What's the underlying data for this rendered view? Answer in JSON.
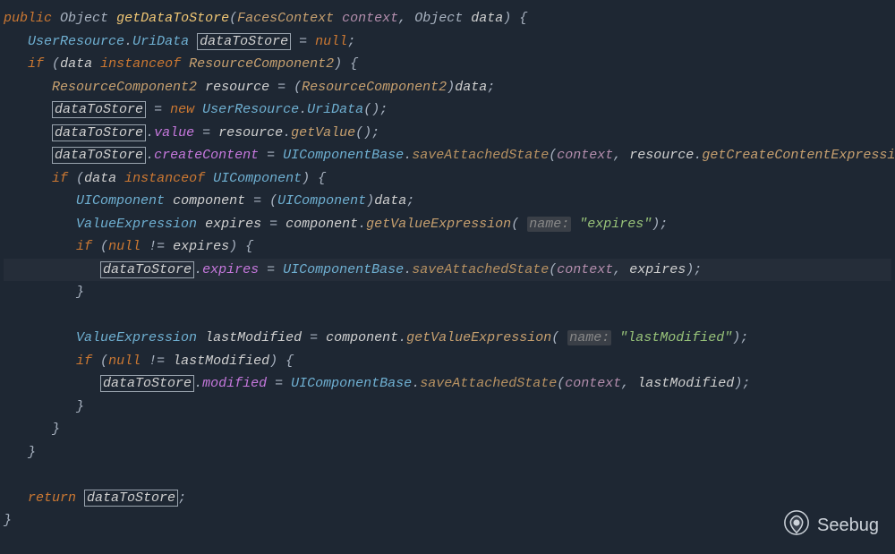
{
  "code": {
    "kw_public": "public",
    "kw_if": "if",
    "kw_new": "new",
    "kw_return": "return",
    "kw_instanceof": "instanceof",
    "kw_null": "null",
    "ne": "!=",
    "assign": "=",
    "t_Object": "Object",
    "t_FacesContext": "FacesContext",
    "t_UserResource": "UserResource",
    "t_UriData": "UriData",
    "t_ResourceComponent2": "ResourceComponent2",
    "t_UIComponentBase": "UIComponentBase",
    "t_UIComponent": "UIComponent",
    "t_ValueExpression": "ValueExpression",
    "m_getDataToStore": "getDataToStore",
    "m_getValue": "getValue",
    "m_saveAttachedState": "saveAttachedState",
    "m_getCreateContentExpression": "getCreateContentExpression",
    "m_getValueExpression": "getValueExpression",
    "v_context": "context",
    "v_data": "data",
    "v_dataToStore": "dataToStore",
    "v_resource": "resource",
    "v_component": "component",
    "v_expires": "expires",
    "v_lastModified": "lastModified",
    "f_value": "value",
    "f_createContent": "createContent",
    "f_expires": "expires",
    "f_modified": "modified",
    "s_expires": "\"expires\"",
    "s_lastModified": "\"lastModified\"",
    "hint_name": "name:"
  },
  "watermark": "Seebug"
}
